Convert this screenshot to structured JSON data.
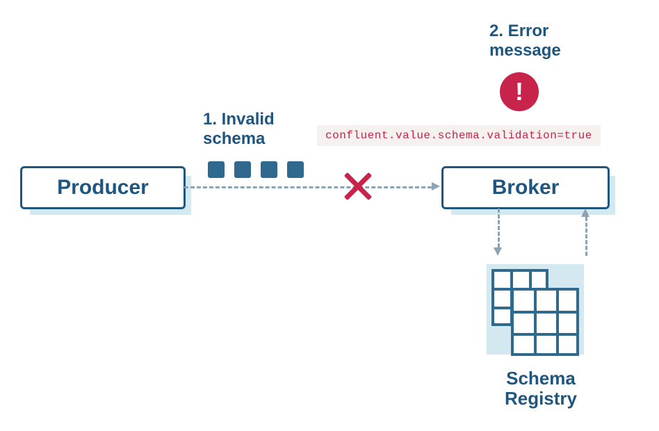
{
  "nodes": {
    "producer": {
      "label": "Producer"
    },
    "broker": {
      "label": "Broker"
    },
    "schema_registry": {
      "label_line1": "Schema",
      "label_line2": "Registry"
    }
  },
  "callouts": {
    "invalid_schema": {
      "label_line1": "1. Invalid",
      "label_line2": "schema"
    },
    "error_message": {
      "label_line1": "2. Error",
      "label_line2": "message"
    }
  },
  "config": {
    "validation_property": "confluent.value.schema.validation=true"
  },
  "icons": {
    "error_badge_glyph": "!",
    "cross": "cross-icon",
    "message_square": "message-icon",
    "grid": "grid-icon"
  },
  "colors": {
    "primary": "#1f5680",
    "primary_fill": "#2f6a8e",
    "shadow": "#cfe5ef",
    "danger": "#c7234b",
    "line": "#8aa4b3",
    "config_bg": "#f4f1ef"
  }
}
